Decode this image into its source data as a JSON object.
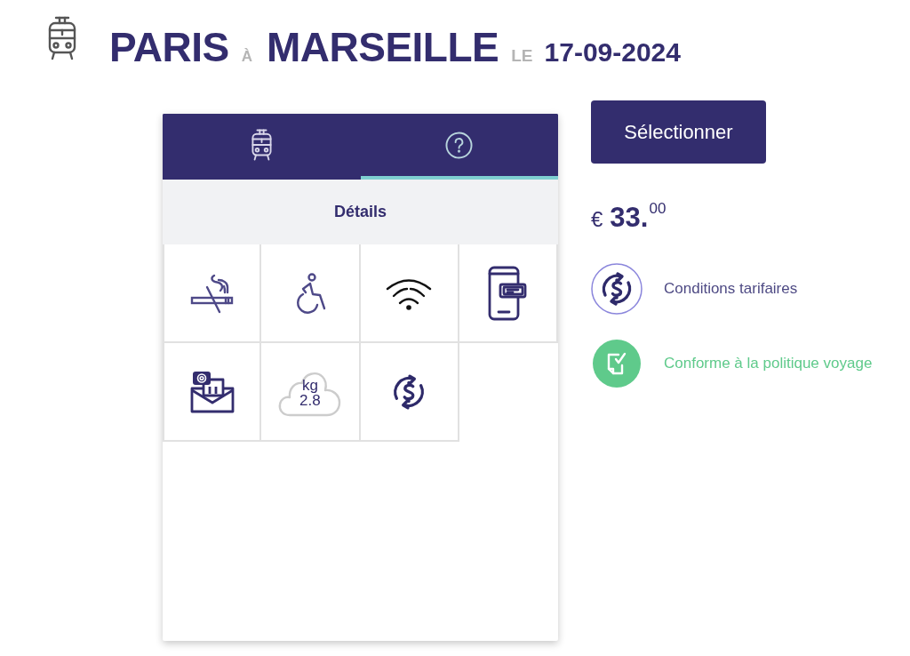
{
  "header": {
    "origin": "PARIS",
    "connector": "À",
    "destination": "MARSEILLE",
    "date_label": "LE",
    "date": "17-09-2024"
  },
  "tabs": [
    {
      "kind": "train",
      "selected": false
    },
    {
      "kind": "help",
      "selected": true
    }
  ],
  "section_title": "Détails",
  "amenities": [
    {
      "kind": "no-smoking"
    },
    {
      "kind": "wheelchair"
    },
    {
      "kind": "wifi"
    },
    {
      "kind": "mobile-ticket"
    },
    {
      "kind": "email-ticket"
    },
    {
      "kind": "co2",
      "unit": "kg",
      "value": "2.8"
    },
    {
      "kind": "fare-conditions"
    }
  ],
  "select_button": "Sélectionner",
  "price": {
    "currency": "€",
    "whole": "33.",
    "cents": "00"
  },
  "info": [
    {
      "kind": "fare-conditions",
      "label": "Conditions tarifaires"
    },
    {
      "kind": "policy",
      "label": "Conforme à la politique voyage"
    }
  ]
}
